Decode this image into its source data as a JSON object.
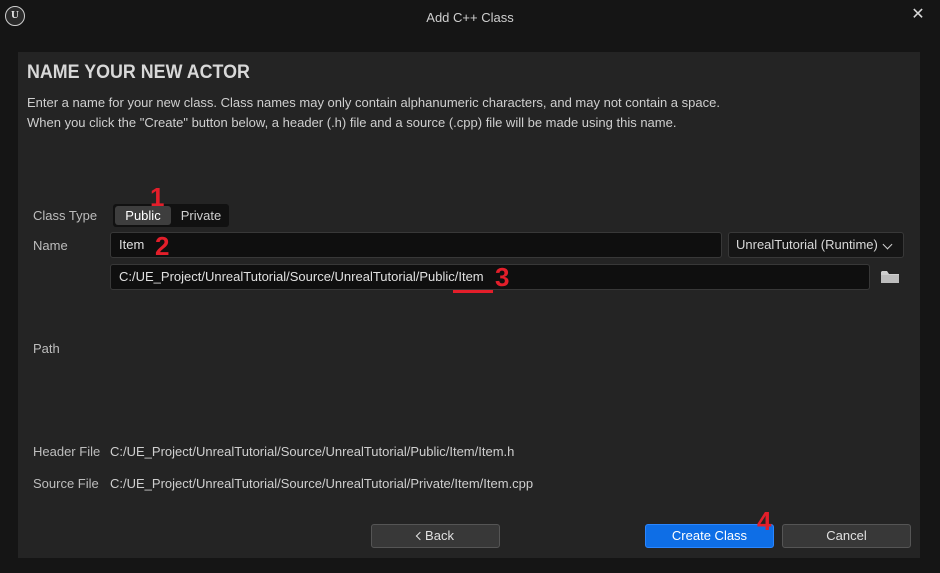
{
  "window": {
    "title": "Add C++ Class"
  },
  "heading": "NAME YOUR NEW ACTOR",
  "description": {
    "line1": "Enter a name for your new class. Class names may only contain alphanumeric characters, and may not contain a space.",
    "line2": "When you click the \"Create\" button below, a header (.h) file and a source (.cpp) file will be made using this name."
  },
  "form": {
    "class_type": {
      "label": "Class Type",
      "options": [
        "Public",
        "Private"
      ],
      "selected": "Public"
    },
    "name": {
      "label": "Name",
      "value": "Item"
    },
    "module": {
      "selected": "UnrealTutorial (Runtime)"
    },
    "path": {
      "label": "Path",
      "value": "C:/UE_Project/UnrealTutorial/Source/UnrealTutorial/Public/Item"
    },
    "header_file": {
      "label": "Header File",
      "value": "C:/UE_Project/UnrealTutorial/Source/UnrealTutorial/Public/Item/Item.h"
    },
    "source_file": {
      "label": "Source File",
      "value": "C:/UE_Project/UnrealTutorial/Source/UnrealTutorial/Private/Item/Item.cpp"
    }
  },
  "buttons": {
    "back": "Back",
    "create": "Create Class",
    "cancel": "Cancel"
  },
  "annotations": [
    "1",
    "2",
    "3",
    "4"
  ],
  "icons": {
    "logo": "unreal-logo-icon",
    "close": "close-icon",
    "folder": "folder-icon",
    "dropdown": "chevron-down-icon",
    "back": "chevron-left-icon"
  },
  "colors": {
    "annotation": "#e31e2a",
    "primary_button": "#0e6ee6",
    "panel": "#242424",
    "window": "#151515"
  }
}
